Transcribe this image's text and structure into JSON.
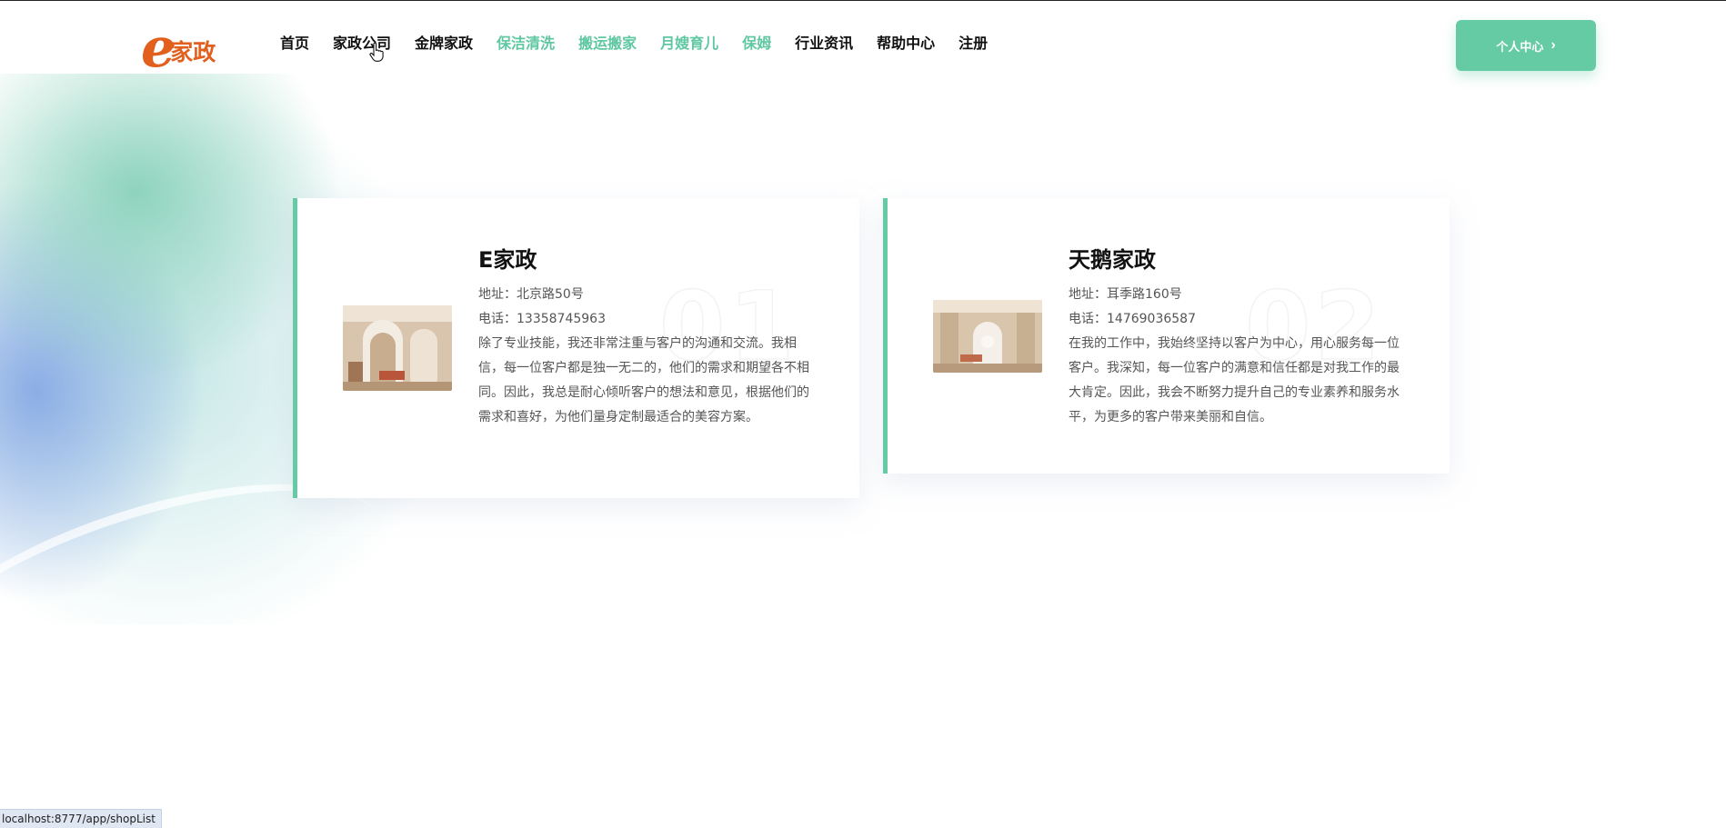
{
  "brand": {
    "logo_e": "e",
    "logo_text": "家政"
  },
  "nav": {
    "items": [
      {
        "label": "首页",
        "color": "#111111"
      },
      {
        "label": "家政公司",
        "color": "#111111"
      },
      {
        "label": "金牌家政",
        "color": "#111111"
      },
      {
        "label": "保洁清洗",
        "color": "#5fc7a2"
      },
      {
        "label": "搬运搬家",
        "color": "#5fc7a2"
      },
      {
        "label": "月嫂育儿",
        "color": "#5fc7a2"
      },
      {
        "label": "保姆",
        "color": "#5fc7a2"
      },
      {
        "label": "行业资讯",
        "color": "#111111"
      },
      {
        "label": "帮助中心",
        "color": "#111111"
      },
      {
        "label": "注册",
        "color": "#111111"
      }
    ]
  },
  "header": {
    "personal_center_label": "个人中心"
  },
  "cards": [
    {
      "number": "01",
      "title": "E家政",
      "address": "地址：北京路50号",
      "phone": "电话：13358745963",
      "description": "除了专业技能，我还非常注重与客户的沟通和交流。我相信，每一位客户都是独一无二的，他们的需求和期望各不相同。因此，我总是耐心倾听客户的想法和意见，根据他们的需求和喜好，为他们量身定制最适合的美容方案。"
    },
    {
      "number": "02",
      "title": "天鹅家政",
      "address": "地址：耳季路160号",
      "phone": "电话：14769036587",
      "description": "在我的工作中，我始终坚持以客户为中心，用心服务每一位客户。我深知，每一位客户的满意和信任都是对我工作的最大肯定。因此，我会不断努力提升自己的专业素养和服务水平，为更多的客户带来美丽和自信。"
    }
  ],
  "status_bar": {
    "url": "localhost:8777/app/shopList"
  },
  "colors": {
    "accent": "#65cba5",
    "logo": "#e2601e"
  }
}
